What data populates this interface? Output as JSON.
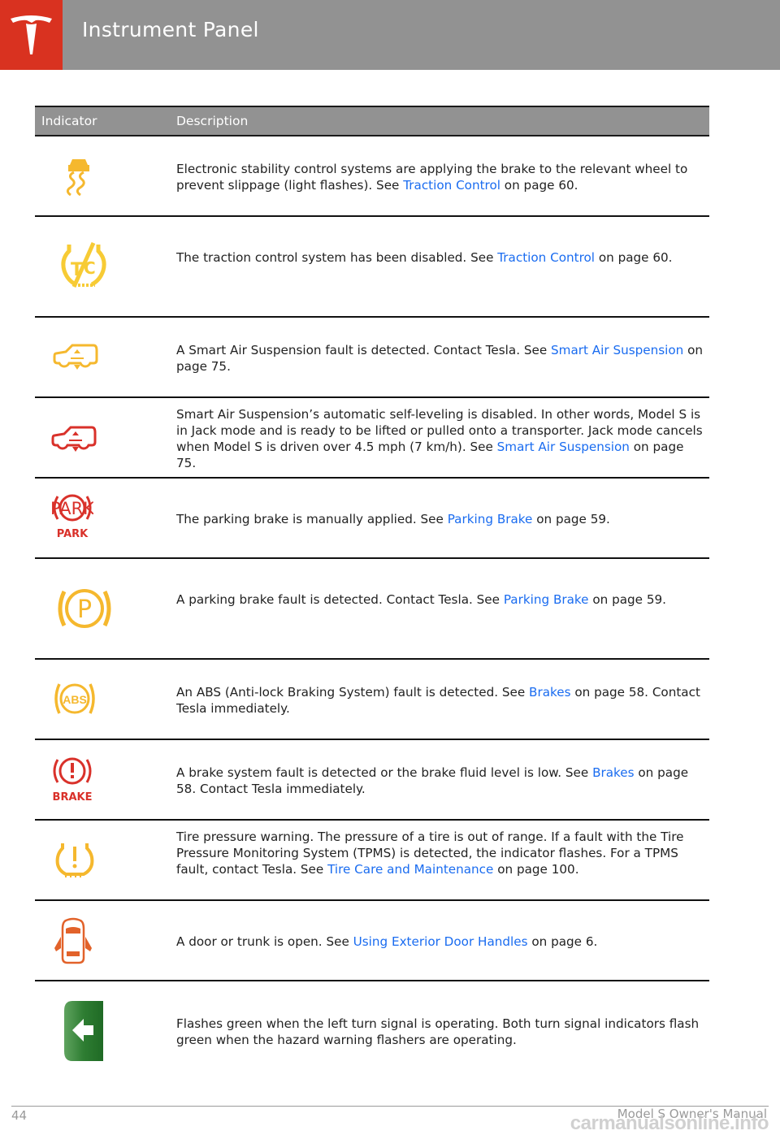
{
  "header": {
    "title": "Instrument Panel",
    "brand_color": "#d93220"
  },
  "table": {
    "columns": [
      "Indicator",
      "Description"
    ],
    "link_color": "#1a6cf0",
    "rows": [
      {
        "icon": "traction-control-active-icon",
        "icon_color": "#f5b82e",
        "pre": "Electronic stability control systems are applying the brake to the relevant wheel to prevent slippage (light flashes). See ",
        "link": "Traction Control",
        "post": " on page 60."
      },
      {
        "icon": "traction-control-off-icon",
        "icon_color": "#f7cb35",
        "pre": "The traction control system has been disabled. See ",
        "link": "Traction Control",
        "post": " on page 60."
      },
      {
        "icon": "air-suspension-fault-icon",
        "icon_color": "#f5b82e",
        "pre": "A Smart Air Suspension fault is detected. Contact Tesla. See ",
        "link": "Smart Air Suspension",
        "post": " on page 75."
      },
      {
        "icon": "jack-mode-icon",
        "icon_color": "#d9312a",
        "pre": "Smart Air Suspension’s automatic self-leveling is disabled. In other words, Model S is in Jack mode and is ready to be lifted or pulled onto a transporter. Jack mode cancels when Model S is driven over 4.5 mph (7 km/h). See ",
        "link": "Smart Air Suspension",
        "post": " on page 75."
      },
      {
        "icon": "parking-brake-applied-icon",
        "icon_color": "#d9312a",
        "icon_label": "PARK",
        "pre": "The parking brake is manually applied. See ",
        "link": "Parking Brake",
        "post": " on page 59."
      },
      {
        "icon": "parking-brake-fault-icon",
        "icon_color": "#f5b82e",
        "icon_label": "P",
        "pre": "A parking brake fault is detected. Contact Tesla. See ",
        "link": "Parking Brake",
        "post": " on page 59."
      },
      {
        "icon": "abs-fault-icon",
        "icon_color": "#f5b82e",
        "icon_label": "ABS",
        "pre": "An ABS (Anti-lock Braking System) fault is detected. See ",
        "link": "Brakes",
        "post": " on page 58. Contact Tesla immediately."
      },
      {
        "icon": "brake-fault-icon",
        "icon_color": "#d9312a",
        "icon_label": "BRAKE",
        "pre": "A brake system fault is detected or the brake fluid level is low. See ",
        "link": "Brakes",
        "post": " on page 58. Contact Tesla immediately."
      },
      {
        "icon": "tire-pressure-warning-icon",
        "icon_color": "#f5b82e",
        "pre": "Tire pressure warning. The pressure of a tire is out of range. If a fault with the Tire Pressure Monitoring System (TPMS) is detected, the indicator flashes. For a TPMS fault, contact Tesla. See ",
        "link": "Tire Care and Maintenance",
        "post": " on page 100."
      },
      {
        "icon": "door-open-icon",
        "icon_color": "#e2622a",
        "pre": "A door or trunk is open. See ",
        "link": "Using Exterior Door Handles",
        "post": " on page 6."
      },
      {
        "icon": "left-turn-signal-icon",
        "icon_color": "#2e7d32",
        "pre": "Flashes green when the left turn signal is operating. Both turn signal indicators flash green when the hazard warning flashers are operating.",
        "link": "",
        "post": ""
      }
    ]
  },
  "footer": {
    "page_number": "44",
    "manual_name": "Model S Owner's Manual",
    "watermark": "carmanualsonline.info"
  }
}
